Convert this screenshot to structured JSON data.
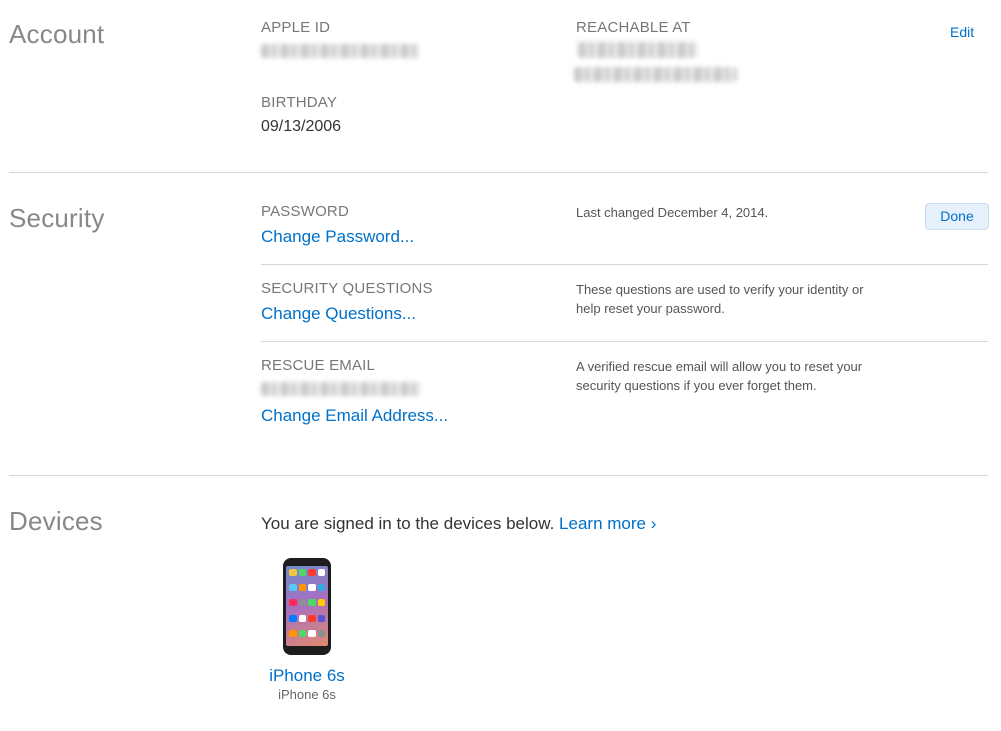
{
  "account": {
    "title": "Account",
    "apple_id_label": "APPLE ID",
    "reachable_label": "REACHABLE AT",
    "edit_label": "Edit",
    "birthday_label": "BIRTHDAY",
    "birthday_value": "09/13/2006"
  },
  "security": {
    "title": "Security",
    "done_label": "Done",
    "password_label": "PASSWORD",
    "password_link": "Change Password...",
    "password_note": "Last changed December 4, 2014.",
    "questions_label": "SECURITY QUESTIONS",
    "questions_link": "Change Questions...",
    "questions_note_line1": "These questions are used to verify your identity or",
    "questions_note_line2": "help reset your password.",
    "rescue_label": "RESCUE EMAIL",
    "rescue_link": "Change Email Address...",
    "rescue_note_line1": "A verified rescue email will allow you to reset your",
    "rescue_note_line2": "security questions if you ever forget them."
  },
  "devices": {
    "title": "Devices",
    "intro": "You are signed in to the devices below.",
    "learn_more": "Learn more ›",
    "items": [
      {
        "name": "iPhone 6s",
        "model": "iPhone 6s"
      }
    ]
  },
  "colors": {
    "link": "#0070c9",
    "section_title": "#888888",
    "divider": "#d6d6d6"
  },
  "icons": {
    "device": "iphone-icon"
  }
}
